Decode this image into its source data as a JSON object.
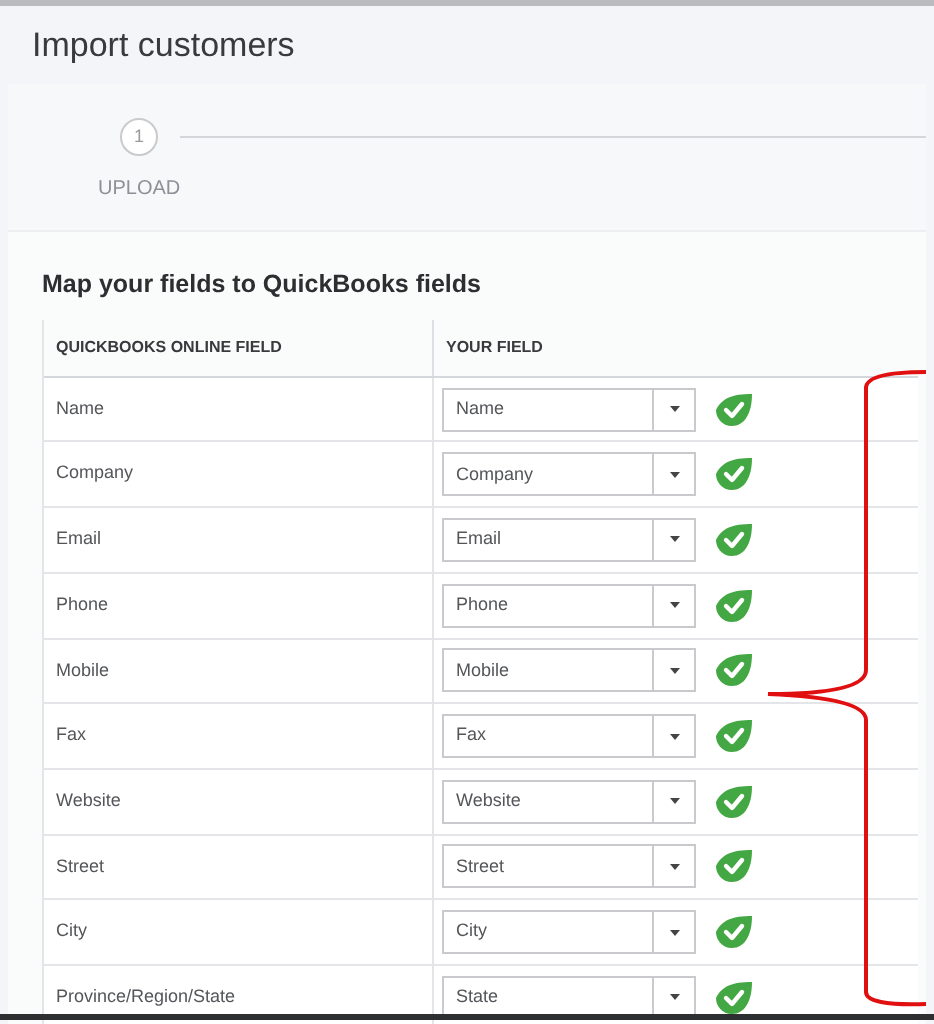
{
  "page_title": "Import customers",
  "stepper": [
    {
      "number": "1",
      "label": "UPLOAD"
    }
  ],
  "section_title": "Map your fields to QuickBooks fields",
  "table": {
    "columns": [
      "QUICKBOOKS ONLINE FIELD",
      "YOUR FIELD"
    ],
    "rows": [
      {
        "field": "Name",
        "value": "Name",
        "matched": true
      },
      {
        "field": "Company",
        "value": "Company",
        "matched": true
      },
      {
        "field": "Email",
        "value": "Email",
        "matched": true
      },
      {
        "field": "Phone",
        "value": "Phone",
        "matched": true
      },
      {
        "field": "Mobile",
        "value": "Mobile",
        "matched": true
      },
      {
        "field": "Fax",
        "value": "Fax",
        "matched": true
      },
      {
        "field": "Website",
        "value": "Website",
        "matched": true
      },
      {
        "field": "Street",
        "value": "Street",
        "matched": true
      },
      {
        "field": "City",
        "value": "City",
        "matched": true
      },
      {
        "field": "Province/Region/State",
        "value": "State",
        "matched": true
      }
    ]
  }
}
